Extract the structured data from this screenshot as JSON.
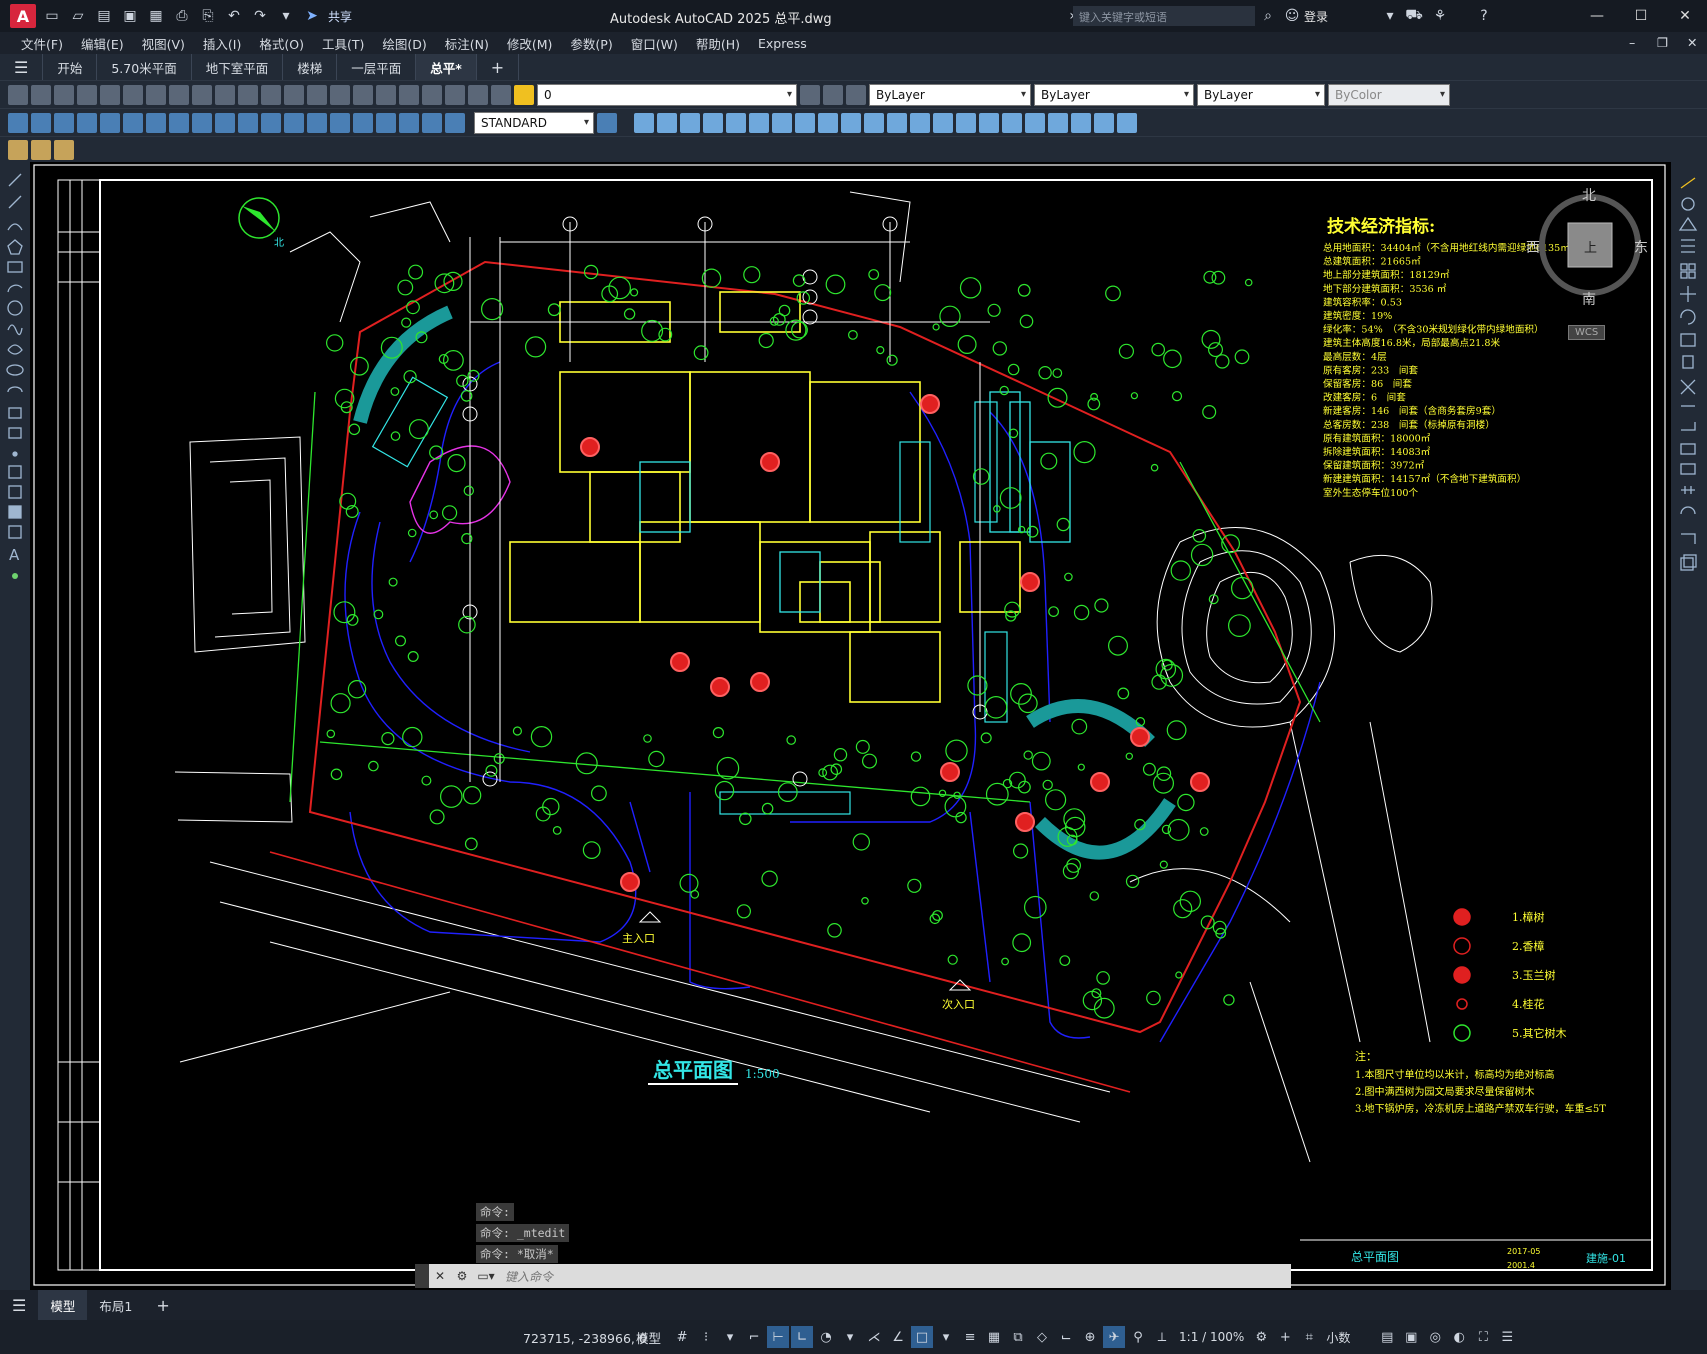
{
  "app": {
    "logo_letter": "A",
    "title": "Autodesk AutoCAD 2025    总平.dwg",
    "share_label": "共享",
    "search_placeholder": "键入关键字或短语",
    "login_label": "登录"
  },
  "menu": [
    "文件(F)",
    "编辑(E)",
    "视图(V)",
    "插入(I)",
    "格式(O)",
    "工具(T)",
    "绘图(D)",
    "标注(N)",
    "修改(M)",
    "参数(P)",
    "窗口(W)",
    "帮助(H)",
    "Express"
  ],
  "file_tabs": [
    {
      "label": "开始"
    },
    {
      "label": "5.70米平面"
    },
    {
      "label": "地下室平面"
    },
    {
      "label": "楼梯"
    },
    {
      "label": "一层平面"
    },
    {
      "label": "总平*"
    }
  ],
  "toolbar": {
    "layer_value": "0",
    "text_style": "STANDARD",
    "color_value": "ByLayer",
    "linetype_value": "ByLayer",
    "lineweight_value": "ByLayer",
    "plotstyle_value": "ByColor"
  },
  "viewcube": {
    "north": "北",
    "south": "南",
    "east": "东",
    "west": "西",
    "top": "上",
    "wcs": "WCS"
  },
  "drawing": {
    "tech_title": "技术经济指标:",
    "tech_lines": [
      "总用地面积：34404㎡（不含用地红线内需迎绿地6135㎡）",
      "总建筑面积：21665㎡",
      "地上部分建筑面积：18129㎡",
      "地下部分建筑面积：3536 ㎡",
      "建筑容积率：0.53",
      "建筑密度：19%",
      "绿化率：54%　（不含30米规划绿化带内绿地面积）",
      "建筑主体高度16.8米，局部最高点21.8米",
      "最高层数：4层",
      "原有客房：233　间套",
      "保留客房：86　间套",
      "改建客房：6　间套",
      "新建客房：146　间套（含商务套房9套）",
      "总客房数：238　间套（标掉原有洞楼）",
      "原有建筑面积：18000㎡",
      "拆除建筑面积：14083㎡",
      "保留建筑面积：3972㎡",
      "新建建筑面积：14157㎡（不含地下建筑面积）",
      "室外生态停车位100个"
    ],
    "legend": [
      "1.樟树",
      "2.香樟",
      "3.玉兰树",
      "4.桂花",
      "5.其它树木"
    ],
    "notes_title": "注：",
    "notes": [
      "1.本图尺寸单位均以米计，标高均为绝对标高",
      "2.图中满西树为园文局要求尽量保留树木",
      "3.地下锅炉房，冷冻机房上道路产禁双车行驶，车重≤5T"
    ],
    "plan_title": "总平面图",
    "plan_scale": "1:500",
    "main_entrance": "主入口",
    "second_entrance": "次入口",
    "north_label": "北",
    "titleblock_name": "总平面图",
    "titleblock_code": "建施-01",
    "titleblock_date1": "2017-05",
    "titleblock_date2": "2001.4"
  },
  "command": {
    "history": [
      "命令:",
      "命令: _mtedit",
      "命令: *取消*"
    ],
    "placeholder": "键入命令"
  },
  "layout_tabs": [
    "模型",
    "布局1"
  ],
  "status": {
    "coords": "723715, -238966, 0",
    "model_label": "模型",
    "scale": "1:1 / 100%",
    "units": "小数"
  },
  "colors": {
    "accent": "#d7263d",
    "canvas": "#000000",
    "frame": "#ffffff",
    "tree_green": "#2ee62e",
    "red_line": "#e02020",
    "yellow": "#ffff33",
    "cyan": "#33e6e6",
    "magenta": "#e633e6",
    "blue": "#2020ff"
  }
}
